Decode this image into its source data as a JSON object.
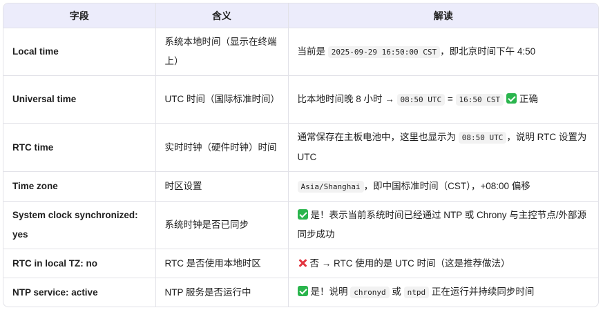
{
  "headers": [
    "字段",
    "含义",
    "解读"
  ],
  "rows": [
    {
      "field": "Local time",
      "meaning": "系统本地时间（显示在终端上）",
      "interp": {
        "prefix": "当前是 ",
        "code1": "2025-09-29 16:50:00 CST",
        "suffix": "，即北京时间下午 4:50"
      }
    },
    {
      "field": "Universal time",
      "meaning": "UTC 时间（国际标准时间）",
      "interp": {
        "prefix": "比本地时间晚 8 小时 → ",
        "code1": "08:50 UTC",
        "mid": " = ",
        "code2": "16:50 CST",
        "icon": "check-icon",
        "suffix": "正确"
      }
    },
    {
      "field": "RTC time",
      "meaning": "实时时钟（硬件时钟）时间",
      "interp": {
        "prefix": "通常保存在主板电池中，这里也显示为 ",
        "code1": "08:50 UTC",
        "suffix": "，说明 RTC 设置为 UTC"
      }
    },
    {
      "field": "Time zone",
      "meaning": "时区设置",
      "interp": {
        "code1": "Asia/Shanghai",
        "suffix": "，即中国标准时间（CST），+08:00 偏移"
      }
    },
    {
      "field": "System clock synchronized: yes",
      "meaning": "系统时钟是否已同步",
      "interp": {
        "icon": "check-icon",
        "suffix": "是！表示当前系统时间已经通过 NTP 或 Chrony 与主控节点/外部源同步成功"
      }
    },
    {
      "field": "RTC in local TZ: no",
      "meaning": "RTC 是否使用本地时区",
      "interp": {
        "icon": "cross-icon",
        "suffix": "否 → RTC 使用的是 UTC 时间（这是推荐做法）"
      }
    },
    {
      "field": "NTP service: active",
      "meaning": "NTP 服务是否运行中",
      "interp": {
        "icon": "check-icon",
        "prefix": "是！说明 ",
        "code1": "chronyd",
        "mid": " 或 ",
        "code2": "ntpd",
        "suffix": " 正在运行并持续同步时间"
      }
    }
  ]
}
